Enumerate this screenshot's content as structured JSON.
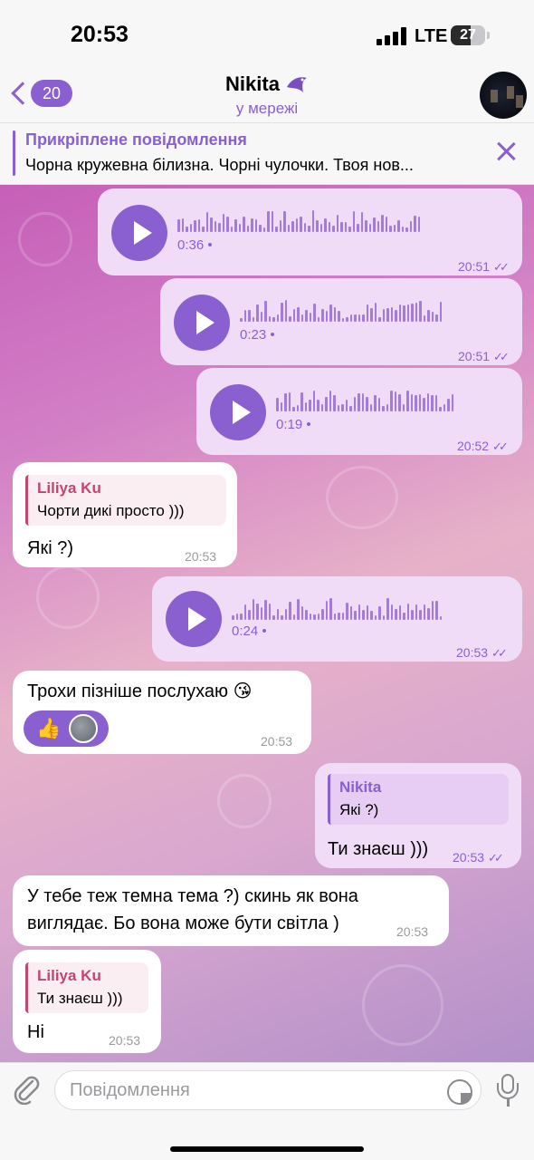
{
  "status_bar": {
    "time": "20:53",
    "network": "LTE",
    "battery": "27"
  },
  "header": {
    "back_count": "20",
    "contact_name": "Nikita",
    "contact_status": "у мережі"
  },
  "pinned": {
    "label": "Прикріплене повідомлення",
    "text": "Чорна кружевна білизна. Чорні чулочки. Твоя нов..."
  },
  "messages": [
    {
      "type": "voice",
      "direction": "out",
      "duration": "0:36",
      "time": "20:51"
    },
    {
      "type": "voice",
      "direction": "out",
      "duration": "0:23",
      "time": "20:51"
    },
    {
      "type": "voice",
      "direction": "out",
      "duration": "0:19",
      "time": "20:52"
    },
    {
      "type": "text",
      "direction": "in",
      "reply_name": "Liliya Ku",
      "reply_text": "Чорти дикі просто )))",
      "text": "Які ?)",
      "time": "20:53"
    },
    {
      "type": "voice",
      "direction": "out",
      "duration": "0:24",
      "time": "20:53"
    },
    {
      "type": "text",
      "direction": "in",
      "text": "Трохи пізніше послухаю 😘",
      "reaction": "👍",
      "time": "20:53"
    },
    {
      "type": "text",
      "direction": "out",
      "reply_name": "Nikita",
      "reply_text": "Які ?)",
      "text": "Ти знаєш )))",
      "time": "20:53"
    },
    {
      "type": "text",
      "direction": "in",
      "text_line1": "У тебе теж темна тема ?) скинь як вона",
      "text_line2": "виглядає. Бо вона може бути світла )",
      "time": "20:53"
    },
    {
      "type": "text",
      "direction": "in",
      "reply_name": "Liliya Ku",
      "reply_text": "Ти знаєш )))",
      "text": "Ні",
      "time": "20:53"
    }
  ],
  "composer": {
    "placeholder": "Повідомлення"
  },
  "colors": {
    "accent": "#8a5fd0",
    "outgoing_bubble": "#f1dcf7",
    "incoming_bubble": "#ffffff"
  }
}
